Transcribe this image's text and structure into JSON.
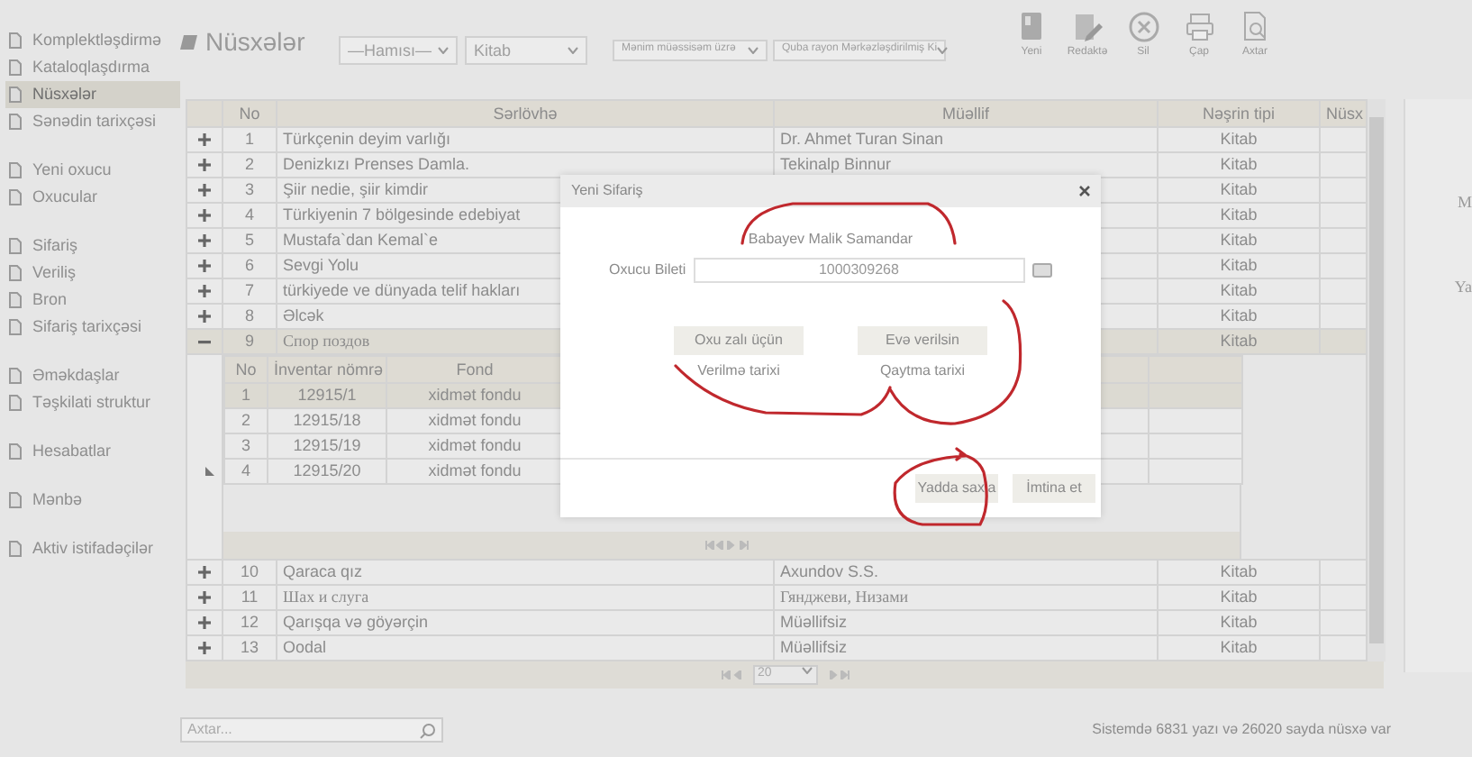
{
  "sidebar": {
    "groups": [
      [
        {
          "label": "Komplektləşdirmə",
          "selected": false
        },
        {
          "label": "Kataloqlaşdırma",
          "selected": false
        },
        {
          "label": "Nüsxələr",
          "selected": true
        },
        {
          "label": "Sənədin tarixçəsi",
          "selected": false
        }
      ],
      [
        {
          "label": "Yeni oxucu",
          "selected": false
        },
        {
          "label": "Oxucular",
          "selected": false
        }
      ],
      [
        {
          "label": "Sifariş",
          "selected": false
        },
        {
          "label": "Veriliş",
          "selected": false
        },
        {
          "label": "Bron",
          "selected": false
        },
        {
          "label": "Sifariş tarixçəsi",
          "selected": false
        }
      ],
      [
        {
          "label": "Əməkdaşlar",
          "selected": false
        },
        {
          "label": "Təşkilati struktur",
          "selected": false
        }
      ],
      [
        {
          "label": "Hesabatlar",
          "selected": false
        }
      ],
      [
        {
          "label": "Mənbə",
          "selected": false
        }
      ],
      [
        {
          "label": "Aktiv istifadəçilər",
          "selected": false
        }
      ]
    ]
  },
  "page_title": "Nüsxələr",
  "filters": [
    {
      "value": "—Hamısı—",
      "kind": "large"
    },
    {
      "value": "Kitab",
      "kind": "large"
    },
    {
      "value": "Mənim müəssisəm üzrə",
      "kind": "small"
    },
    {
      "value": "Quba rayon Mərkəzləşdirilmiş Ki",
      "kind": "small"
    }
  ],
  "toolbar": [
    {
      "kind": "new",
      "label": "Yeni"
    },
    {
      "kind": "edit",
      "label": "Redaktə"
    },
    {
      "kind": "delete",
      "label": "Sil"
    },
    {
      "kind": "print",
      "label": "Çap"
    },
    {
      "kind": "search",
      "label": "Axtar"
    }
  ],
  "table": {
    "columns": [
      "No",
      "Sərlövhə",
      "Müəllif",
      "Nəşrin tipi",
      "Nüsx"
    ],
    "rows": [
      {
        "expanded": false,
        "no": "1",
        "title": "Türkçenin deyim varlığı",
        "author": "Dr. Ahmet Turan Sinan",
        "type": "Kitab"
      },
      {
        "expanded": false,
        "no": "2",
        "title": "Denizkızı Prenses Damla.",
        "author": "Tekinalp Binnur",
        "type": "Kitab"
      },
      {
        "expanded": false,
        "no": "3",
        "title": "Şiir nedie, şiir kimdir",
        "type": "Kitab"
      },
      {
        "expanded": false,
        "no": "4",
        "title": "Türkiyenin 7 bölgesinde edebiyat",
        "type": "Kitab"
      },
      {
        "expanded": false,
        "no": "5",
        "title": "Mustafa`dan Kemal`e",
        "type": "Kitab"
      },
      {
        "expanded": false,
        "no": "6",
        "title": "Sevgi Yolu",
        "type": "Kitab"
      },
      {
        "expanded": false,
        "no": "7",
        "title": "türkiyede ve dünyada telif hakları",
        "type": "Kitab"
      },
      {
        "expanded": false,
        "no": "8",
        "title": "Əlcək",
        "type": "Kitab"
      },
      {
        "expanded": true,
        "no": "9",
        "title": "Спор поздов",
        "type": "Kitab",
        "subgrid": {
          "columns": [
            "No",
            "İnventar nömrə",
            "Fond"
          ],
          "rows": [
            {
              "no": "1",
              "inventory": "12915/1",
              "fund": "xidmət fondu",
              "selected": true,
              "current": false
            },
            {
              "no": "2",
              "inventory": "12915/18",
              "fund": "xidmət fondu",
              "selected": false,
              "current": false
            },
            {
              "no": "3",
              "inventory": "12915/19",
              "fund": "xidmət fondu",
              "selected": false,
              "current": false
            },
            {
              "no": "4",
              "inventory": "12915/20",
              "fund": "xidmət fondu",
              "selected": false,
              "current": true
            }
          ]
        }
      },
      {
        "expanded": false,
        "no": "10",
        "title": "Qaraca qız",
        "author": "Axundov S.S.",
        "type": "Kitab"
      },
      {
        "expanded": false,
        "no": "11",
        "title": "Шах и слуга",
        "author": "Гянджеви, Низами",
        "type": "Kitab"
      },
      {
        "expanded": false,
        "no": "12",
        "title": "Qarışqa və göyərçin",
        "author": "Müəllifsiz",
        "type": "Kitab"
      },
      {
        "expanded": false,
        "no": "13",
        "title": "Oodal",
        "author": "Müəllifsiz",
        "type": "Kitab"
      }
    ]
  },
  "pager": {
    "page_size": "20"
  },
  "search": {
    "placeholder": "Axtar..."
  },
  "status": "Sistemdə 6831 yazı və 26020 sayda nüsxə var",
  "right_panel": [
    "M",
    "Ya"
  ],
  "dialog": {
    "title": "Yeni Sifariş",
    "reader_name": "Babayev Malik Samandar",
    "ticket_label": "Oxucu Bileti",
    "ticket_value": "1000309268",
    "options": [
      {
        "button": "Oxu zalı üçün",
        "caption": "Verilmə tarixi"
      },
      {
        "button": "Evə verilsin",
        "caption": "Qaytma tarixi"
      }
    ],
    "buttons": [
      "Yadda saxla",
      "İmtina et"
    ]
  }
}
